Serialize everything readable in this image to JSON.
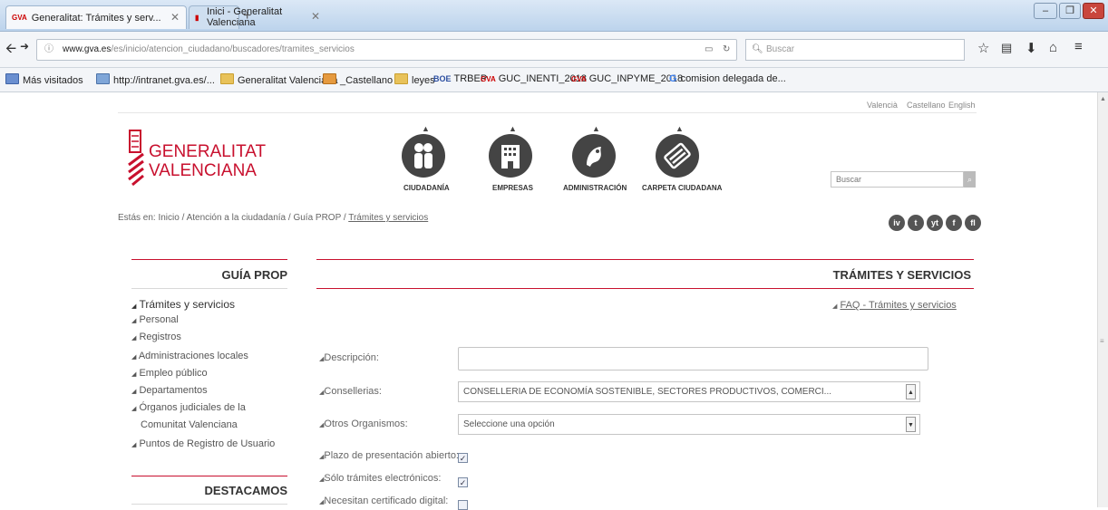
{
  "browser": {
    "tabs": [
      {
        "label": "Generalitat: Trámites y serv...",
        "close": "✕"
      },
      {
        "label": "Inici - Generalitat Valenciana",
        "close": "✕"
      }
    ],
    "new_tab": "+",
    "url_host": "www.gva.es",
    "url_path": "/es/inicio/atencion_ciudadano/buscadores/tramites_servicios",
    "search_placeholder": "Buscar",
    "bookmarks": [
      "Más visitados",
      "http://intranet.gva.es/...",
      "Generalitat Valenciana",
      "_Castellano",
      "leyes",
      "TRBEP",
      "GUC_INENTI_2018",
      "GUC_INPYME_2018",
      "comision delegada de..."
    ]
  },
  "site": {
    "languages": [
      "Valencià",
      "Castellano",
      "English"
    ],
    "logo": [
      "GENERALITAT",
      "VALENCIANA"
    ],
    "nav": [
      "CIUDADANÍA",
      "EMPRESAS",
      "ADMINISTRACIÓN",
      "CARPETA CIUDADANA"
    ],
    "search_placeholder": "Buscar",
    "breadcrumb_prefix": "Estás en: Inicio / Atención a la ciudadanía / Guía PROP / ",
    "breadcrumb_current": "Trámites y servicios",
    "social": [
      "iv",
      "t",
      "yt",
      "f",
      "fl"
    ]
  },
  "sidebar": {
    "title": "GUÍA PROP",
    "items": [
      "Trámites y servicios",
      "Personal",
      "Registros",
      "Administraciones locales",
      "Empleo público",
      "Departamentos",
      "Órganos judiciales de la",
      "Comunitat Valenciana",
      "Puntos de Registro de Usuario"
    ],
    "section2_title": "DESTACAMOS"
  },
  "main": {
    "title": "TRÁMITES Y SERVICIOS",
    "faq_link": "FAQ - Trámites y servicios",
    "labels": {
      "descripcion": "Descripción:",
      "consellerias": "Consellerias:",
      "otros": "Otros Organismos:",
      "plazo": "Plazo de presentación abierto:",
      "electronicos": "Sólo trámites electrónicos:",
      "certificado": "Necesitan certificado digital:"
    },
    "values": {
      "descripcion": "",
      "consellerias": "CONSELLERIA DE ECONOMÍA SOSTENIBLE, SECTORES PRODUCTIVOS, COMERCI...",
      "otros": "Seleccione una opción"
    },
    "checks": {
      "plazo": "✓",
      "electronicos": "✓",
      "certificado": ""
    }
  }
}
